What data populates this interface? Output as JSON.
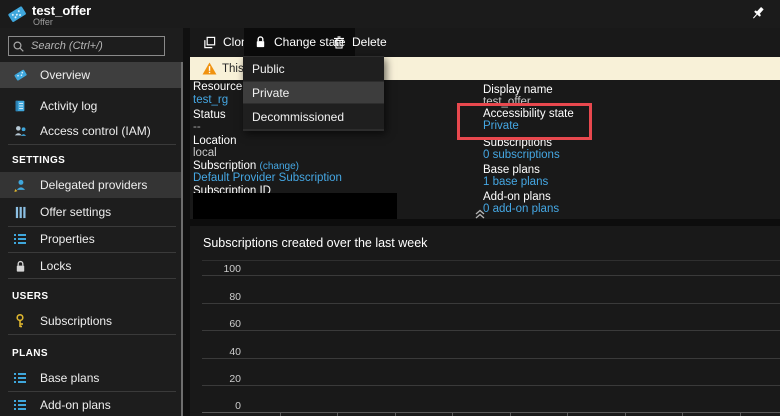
{
  "header": {
    "title": "test_offer",
    "subtitle": "Offer"
  },
  "sidebar": {
    "search_placeholder": "Search (Ctrl+/)",
    "items": [
      {
        "label": "Overview"
      },
      {
        "label": "Activity log"
      },
      {
        "label": "Access control (IAM)"
      },
      {
        "label": "Delegated providers"
      },
      {
        "label": "Offer settings"
      },
      {
        "label": "Properties"
      },
      {
        "label": "Locks"
      },
      {
        "label": "Subscriptions"
      },
      {
        "label": "Base plans"
      },
      {
        "label": "Add-on plans"
      }
    ],
    "section_headers": {
      "settings": "SETTINGS",
      "users": "USERS",
      "plans": "PLANS"
    }
  },
  "toolbar": {
    "clone": "Clone",
    "change_state": "Change state",
    "delete": "Delete"
  },
  "state_menu": {
    "items": [
      {
        "label": "Public"
      },
      {
        "label": "Private"
      },
      {
        "label": "Decommissioned"
      }
    ],
    "highlighted": "Private"
  },
  "banner": {
    "text": "This o"
  },
  "essentials": {
    "left": [
      {
        "label": "Resource group",
        "value": "test_rg"
      },
      {
        "label": "Status",
        "value": "--"
      },
      {
        "label": "Location",
        "value": "local"
      },
      {
        "label": "Subscription",
        "change_link": "(change)",
        "value": "Default Provider Subscription"
      },
      {
        "label": "Subscription ID",
        "value": ""
      }
    ],
    "right": [
      {
        "label": "Display name",
        "value": "test_offer"
      },
      {
        "label": "Accessibility state",
        "value": "Private"
      },
      {
        "label": "Subscriptions",
        "value": "0 subscriptions"
      },
      {
        "label": "Base plans",
        "value": "1 base plans"
      },
      {
        "label": "Add-on plans",
        "value": "0 add-on plans"
      }
    ]
  },
  "chart_data": {
    "type": "line",
    "title": "Subscriptions created over the last week",
    "y_tick_labels": [
      "100",
      "80",
      "60",
      "40",
      "20",
      "0"
    ],
    "ylim": [
      0,
      100
    ],
    "x_tick_count": 9,
    "series": [],
    "grid": true,
    "legend": "none"
  },
  "colors": {
    "accent_cyan": "#45a7e3",
    "highlight_red": "#e8484e",
    "banner_bg": "#f8f1d8",
    "warning_orange": "#f0920f",
    "key_yellow": "#ddb52f"
  }
}
